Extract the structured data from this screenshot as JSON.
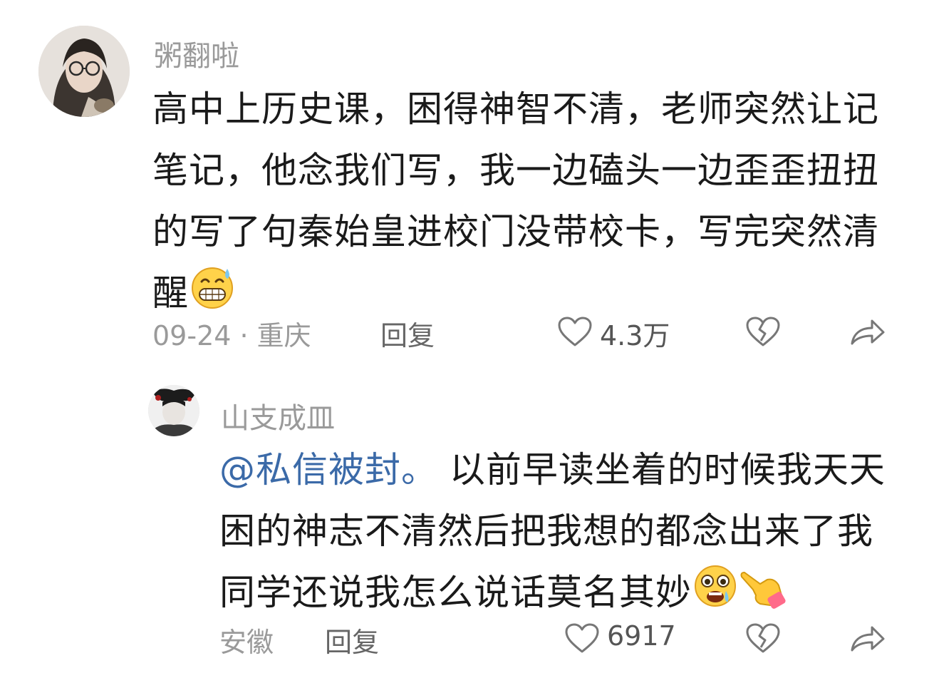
{
  "comments": [
    {
      "username": "粥翻啦",
      "text": "高中上历史课，困得神智不清，老师突然让记笔记，他念我们写，我一边磕头一边歪歪扭扭的写了句秦始皇进校门没带校卡，写完突然清醒",
      "lines": [
        "高中上历史课，困得神智不清，老师突然让记",
        "笔记，他念我们写，我一边磕头一边歪歪扭扭",
        "的写了句秦始皇进校门没带校卡，写完突然清",
        "醒"
      ],
      "emoji": "sweat-grin-emoji",
      "date_location": "09-24 · 重庆",
      "reply_label": "回复",
      "like_count": "4.3万",
      "icons": [
        "heart-icon",
        "broken-heart-icon",
        "share-icon"
      ]
    },
    {
      "username": "山支成皿",
      "mention": "@私信被封。",
      "lines": [
        " 以前早读坐着的时候我天天",
        "困的神志不清然后把我想的都念出来了我",
        "同学还说我怎么说话莫名其妙"
      ],
      "emojis": [
        "scared-crying-emoji",
        "pointing-hand-emoji"
      ],
      "date_location": "安徽",
      "reply_label": "回复",
      "like_count": "6917",
      "icons": [
        "heart-icon",
        "broken-heart-icon",
        "share-icon"
      ]
    }
  ]
}
